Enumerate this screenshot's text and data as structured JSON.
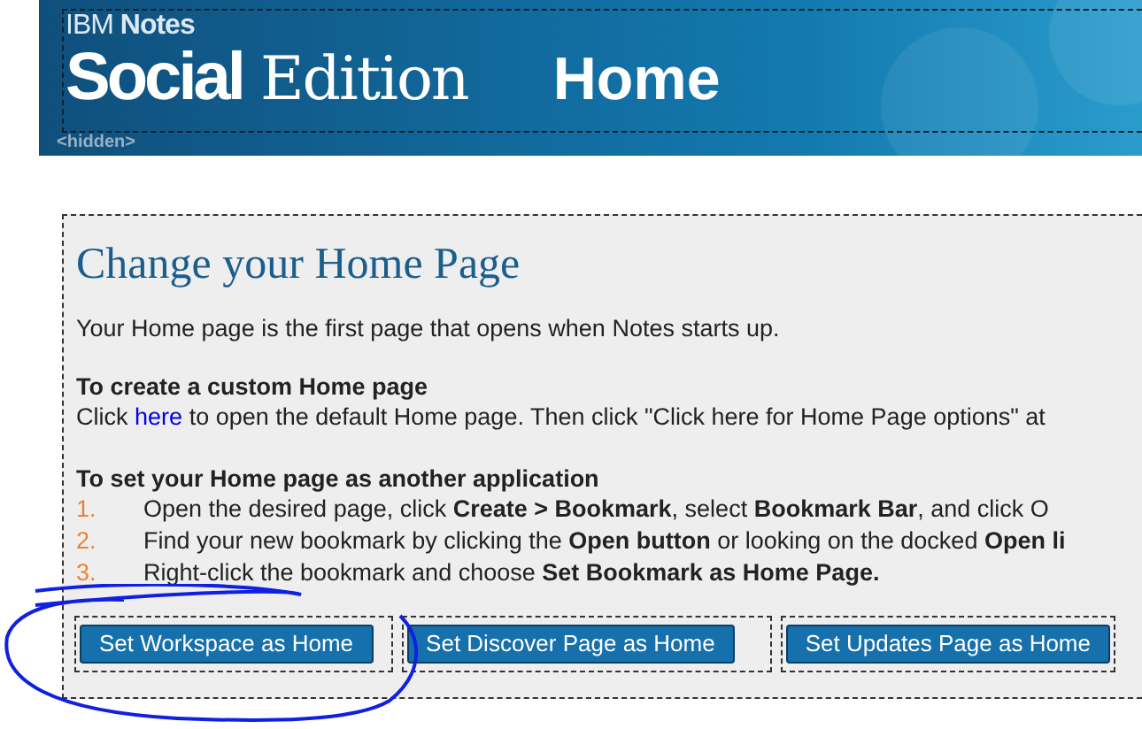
{
  "header": {
    "brand": "IBM **Notes**",
    "edition_bold": "Social",
    "edition_light": "Edition",
    "page_title": "Home",
    "hidden_label": "<hidden>"
  },
  "content": {
    "title": "Change your Home Page",
    "intro": "Your Home page is the first page that opens when Notes starts up.",
    "custom_heading": "To create a custom Home page",
    "custom_before": "Click",
    "custom_link": "here",
    "custom_after": "to open the default Home page. Then click \"Click here for Home Page options\" at",
    "app_heading": "To set your Home page as another application",
    "steps": [
      {
        "number": "1.",
        "text": "Open the desired page, click **Create > Bookmark**, select **Bookmark Bar**, and click O"
      },
      {
        "number": "2.",
        "text": "Find your new bookmark by clicking the **Open button** or looking on the docked **Open li**"
      },
      {
        "number": "3.",
        "text": "Right-click the bookmark and choose **Set Bookmark as Home Page.**"
      }
    ],
    "buttons": [
      "Set Workspace as Home",
      "Set Discover Page as Home",
      "Set Updates Page as Home"
    ]
  }
}
